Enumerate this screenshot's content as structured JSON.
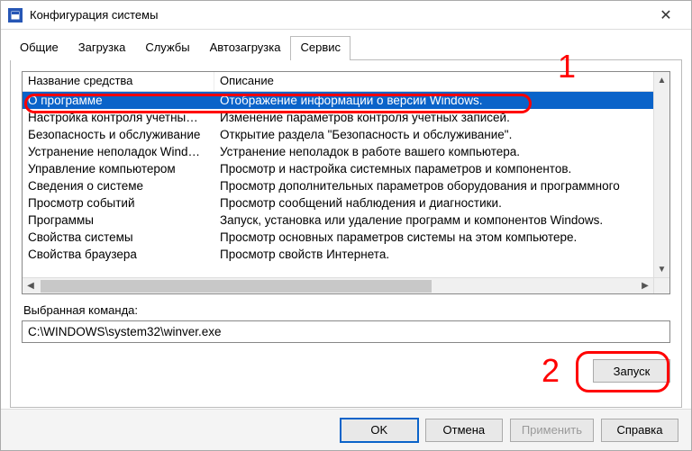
{
  "window": {
    "title": "Конфигурация системы"
  },
  "tabs": [
    "Общие",
    "Загрузка",
    "Службы",
    "Автозагрузка",
    "Сервис"
  ],
  "active_tab": 4,
  "columns": {
    "name": "Название средства",
    "desc": "Описание"
  },
  "rows": [
    {
      "name": "О программе",
      "desc": "Отображение информации о версии Windows."
    },
    {
      "name": "Настройка контроля учетны…",
      "desc": "Изменение параметров контроля учетных записей."
    },
    {
      "name": "Безопасность и обслуживание",
      "desc": "Открытие раздела \"Безопасность и обслуживание\"."
    },
    {
      "name": "Устранение неполадок Wind…",
      "desc": "Устранение неполадок в работе вашего компьютера."
    },
    {
      "name": "Управление компьютером",
      "desc": "Просмотр и настройка системных параметров и компонентов."
    },
    {
      "name": "Сведения о системе",
      "desc": "Просмотр дополнительных параметров оборудования и программного"
    },
    {
      "name": "Просмотр событий",
      "desc": "Просмотр сообщений наблюдения и диагностики."
    },
    {
      "name": "Программы",
      "desc": "Запуск, установка или удаление программ и компонентов Windows."
    },
    {
      "name": "Свойства системы",
      "desc": "Просмотр основных параметров системы на этом компьютере."
    },
    {
      "name": "Свойства браузера",
      "desc": "Просмотр свойств Интернета."
    }
  ],
  "selected_row": 0,
  "selected_label": "Выбранная команда:",
  "selected_command": "C:\\WINDOWS\\system32\\winver.exe",
  "buttons": {
    "launch": "Запуск",
    "ok": "OK",
    "cancel": "Отмена",
    "apply": "Применить",
    "help": "Справка"
  },
  "annotations": {
    "n1": "1",
    "n2": "2"
  }
}
